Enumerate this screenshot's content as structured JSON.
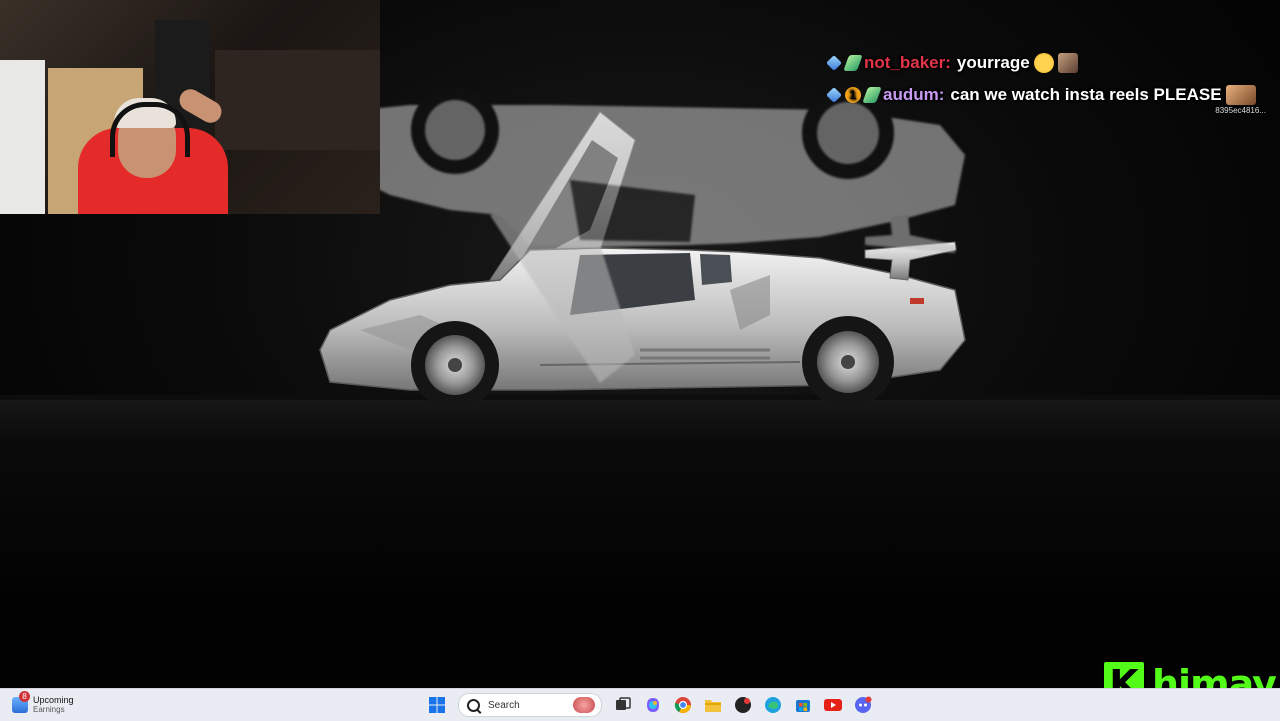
{
  "chat": {
    "messages": [
      {
        "user": "not_baker:",
        "text": "yourrage",
        "user_color": "#e4344a",
        "badges": [
          "sword-badge",
          "slash-badge"
        ],
        "emotes": [
          "heart-eyes-emote",
          "photo-emote"
        ]
      },
      {
        "user": "audum:",
        "text": "can we watch insta reels PLEASE",
        "user_color": "#c79bf2",
        "badges": [
          "sword-badge",
          "one-badge",
          "slash-badge"
        ],
        "emotes": [
          "photo-emote"
        ]
      }
    ],
    "message_id": "8395ec4816...",
    "one_badge_label": "1"
  },
  "logo": {
    "letter": "K",
    "name": "himay",
    "color": "#53fc18"
  },
  "taskbar": {
    "widget_badge": "8",
    "widget_title": "Upcoming",
    "widget_subtitle": "Earnings",
    "search_placeholder": "Search",
    "pinned_apps": [
      "windows-start-icon",
      "search-box",
      "task-view-icon",
      "copilot-icon",
      "chrome-icon",
      "app-icon",
      "file-explorer-icon",
      "edge-icon",
      "microsoft-store-icon",
      "youtube-icon",
      "discord-icon"
    ]
  },
  "colors": {
    "taskbar_bg": "#e9edf3",
    "background": "#060606",
    "kick_green": "#53fc18"
  }
}
